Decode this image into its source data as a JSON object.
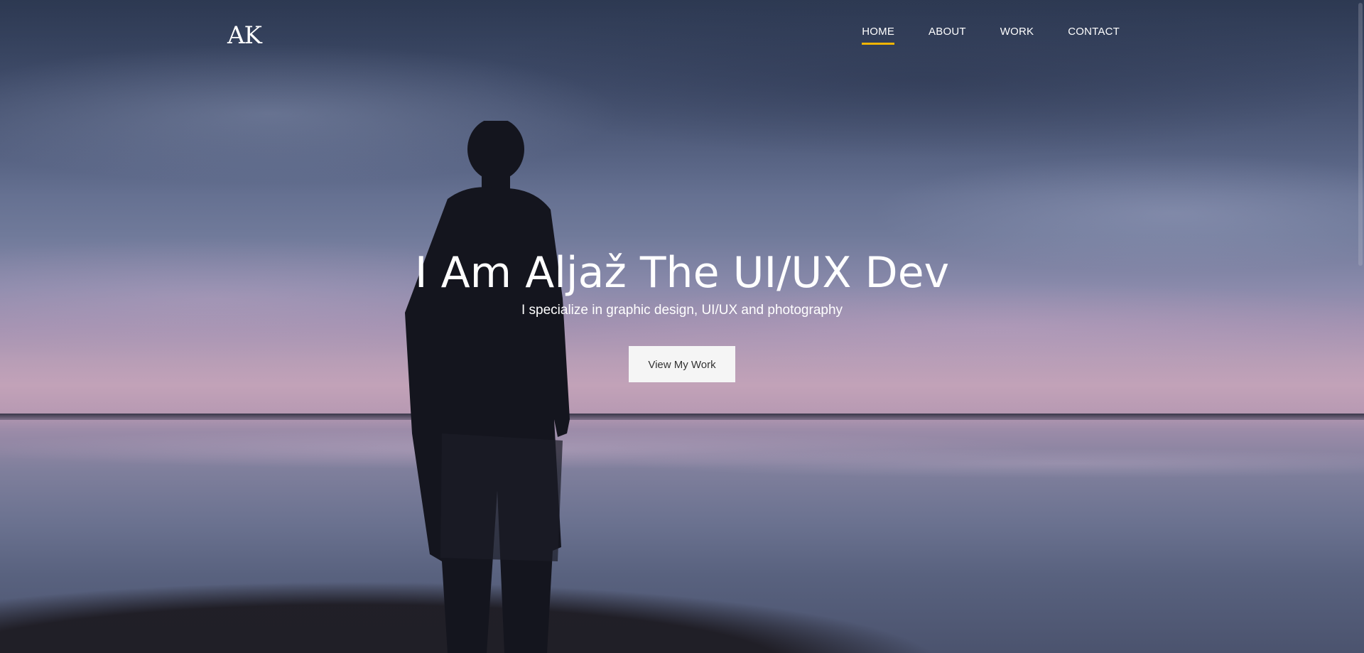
{
  "brand": {
    "logo_text": "AK"
  },
  "nav": {
    "items": [
      {
        "label": "HOME",
        "active": true
      },
      {
        "label": "ABOUT",
        "active": false
      },
      {
        "label": "WORK",
        "active": false
      },
      {
        "label": "CONTACT",
        "active": false
      }
    ],
    "active_indicator_color": "#f0b400"
  },
  "hero": {
    "title": "I Am Aljaž The UI/UX Dev",
    "subtitle": "I specialize in graphic design, UI/UX and photography",
    "cta_label": "View My Work"
  },
  "colors": {
    "text": "#ffffff",
    "button_bg": "#f5f5f5",
    "button_text": "#333333"
  }
}
